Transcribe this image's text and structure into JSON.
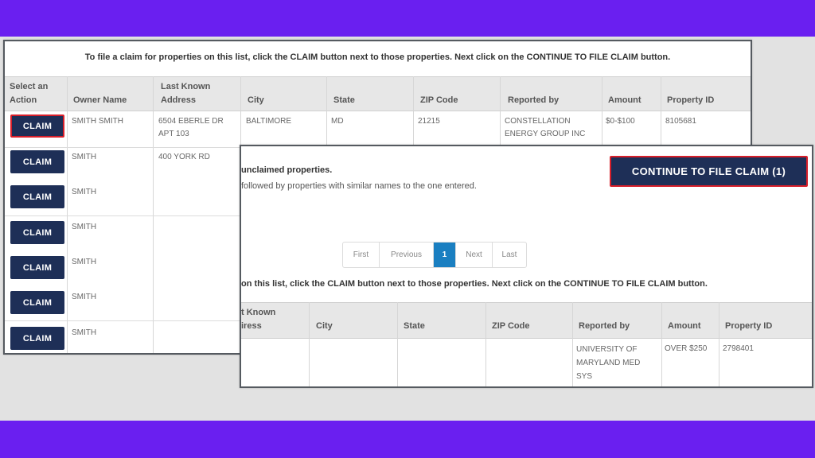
{
  "colors": {
    "band": "#6a1ff0",
    "button": "#1e2f57",
    "highlight": "#d81f2a",
    "page_active": "#1a7fc1"
  },
  "back_panel": {
    "instruction": "To file a claim for properties on this list, click the CLAIM button next to those properties. Next click on the CONTINUE TO FILE CLAIM button.",
    "headers": {
      "action_1": "Select an",
      "action_2": "Action",
      "owner": "Owner Name",
      "address_1": "Last Known",
      "address_2": "Address",
      "city": "City",
      "state": "State",
      "zip": "ZIP Code",
      "reported": "Reported by",
      "amount": "Amount",
      "property_id": "Property ID"
    },
    "claim_label": "CLAIM",
    "rows": [
      {
        "owner": "SMITH SMITH",
        "address_1": "6504 EBERLE DR",
        "address_2": "APT 103",
        "city": "BALTIMORE",
        "state": "MD",
        "zip": "21215",
        "reported_1": "CONSTELLATION",
        "reported_2": "ENERGY GROUP INC",
        "amount": "$0-$100",
        "property_id": "8105681"
      },
      {
        "owner": "SMITH",
        "address_1": "400 YORK RD"
      },
      {
        "owner": "SMITH"
      },
      {
        "owner": "SMITH"
      },
      {
        "owner": "SMITH"
      },
      {
        "owner": "SMITH"
      },
      {
        "owner": "SMITH"
      }
    ]
  },
  "front_panel": {
    "continue_label": "CONTINUE TO FILE CLAIM  (1)",
    "message_bold": "unclaimed properties.",
    "message_text": "followed by properties with similar names to the one entered.",
    "pager": {
      "first": "First",
      "previous": "Previous",
      "current": "1",
      "next": "Next",
      "last": "Last"
    },
    "instruction": "on this list, click the CLAIM button next to those properties. Next click on the CONTINUE TO FILE CLAIM button.",
    "headers": {
      "address_1": "t Known",
      "address_2": "iress",
      "city": "City",
      "state": "State",
      "zip": "ZIP Code",
      "reported": "Reported by",
      "amount": "Amount",
      "property_id": "Property ID"
    },
    "row": {
      "reported_1": "UNIVERSITY OF",
      "reported_2": "MARYLAND MED",
      "reported_3": "SYS",
      "amount": "OVER $250",
      "property_id": "2798401"
    }
  }
}
